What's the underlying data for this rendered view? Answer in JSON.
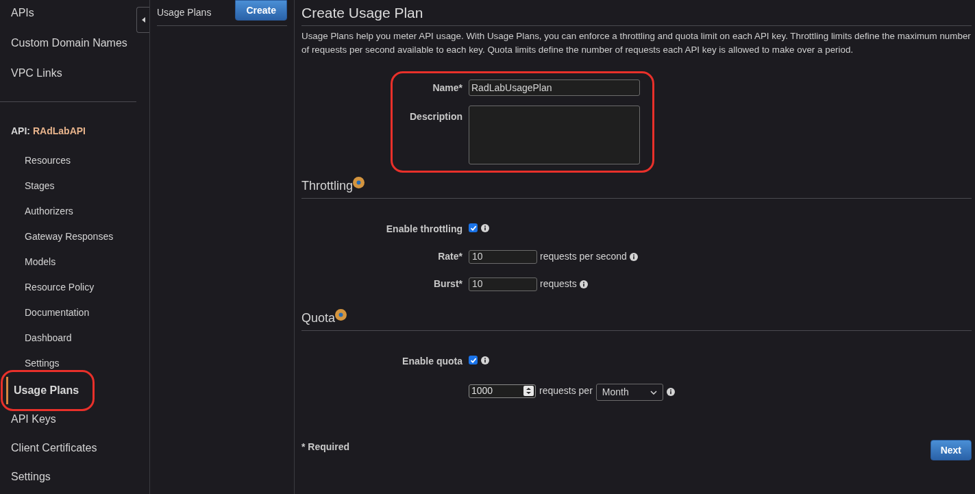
{
  "sidebar": {
    "top_items": [
      {
        "label": "APIs",
        "selected": false
      },
      {
        "label": "Custom Domain Names",
        "selected": false
      },
      {
        "label": "VPC Links",
        "selected": false
      }
    ],
    "api_label": "API:",
    "api_name": "RAdLabAPI",
    "api_items": [
      {
        "label": "Resources",
        "selected": false
      },
      {
        "label": "Stages",
        "selected": false
      },
      {
        "label": "Authorizers",
        "selected": false
      },
      {
        "label": "Gateway Responses",
        "selected": false
      },
      {
        "label": "Models",
        "selected": false
      },
      {
        "label": "Resource Policy",
        "selected": false
      },
      {
        "label": "Documentation",
        "selected": false
      },
      {
        "label": "Dashboard",
        "selected": false
      },
      {
        "label": "Settings",
        "selected": false
      }
    ],
    "bottom_items": [
      {
        "label": "Usage Plans",
        "selected": true,
        "highlighted": true
      },
      {
        "label": "API Keys",
        "selected": false,
        "highlighted": false
      },
      {
        "label": "Client Certificates",
        "selected": false,
        "highlighted": false
      },
      {
        "label": "Settings",
        "selected": false,
        "highlighted": false
      }
    ]
  },
  "list_panel": {
    "title": "Usage Plans",
    "create_button": "Create"
  },
  "main": {
    "title": "Create Usage Plan",
    "intro": "Usage Plans help you meter API usage. With Usage Plans, you can enforce a throttling and quota limit on each API key. Throttling limits define the maximum number of requests per second available to each key. Quota limits define the number of requests each API key is allowed to make over a period.",
    "form": {
      "highlighted": true,
      "name": {
        "label": "Name*",
        "value": "RadLabUsagePlan"
      },
      "description": {
        "label": "Description"
      }
    },
    "throttling": {
      "title": "Throttling",
      "enable": {
        "label": "Enable throttling",
        "checked": true
      },
      "fields": [
        {
          "label": "Rate*",
          "value": "10",
          "unit": "requests per second"
        },
        {
          "label": "Burst*",
          "value": "10",
          "unit": "requests"
        }
      ]
    },
    "quota": {
      "title": "Quota",
      "enable": {
        "label": "Enable quota",
        "checked": true
      },
      "limit": {
        "value": "1000",
        "unit": "requests per",
        "period": "Month"
      }
    },
    "required_note": "* Required",
    "next_button": "Next"
  }
}
